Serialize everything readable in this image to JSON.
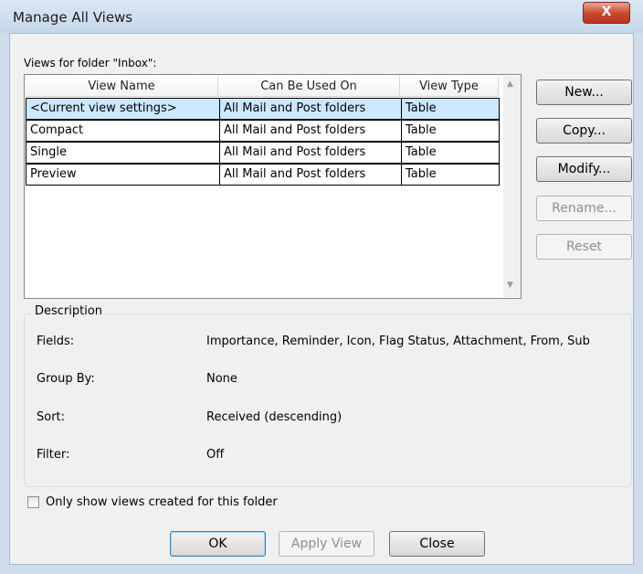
{
  "dialog": {
    "title": "Manage All Views",
    "close_glyph": "X",
    "views_label": "Views for folder \"Inbox\":"
  },
  "table": {
    "columns": [
      "View Name",
      "Can Be Used On",
      "View Type"
    ],
    "rows": [
      {
        "name": "<Current view settings>",
        "used_on": "All Mail and Post folders",
        "type": "Table",
        "selected": true
      },
      {
        "name": "Compact",
        "used_on": "All Mail and Post folders",
        "type": "Table",
        "selected": false
      },
      {
        "name": "Single",
        "used_on": "All Mail and Post folders",
        "type": "Table",
        "selected": false
      },
      {
        "name": "Preview",
        "used_on": "All Mail and Post folders",
        "type": "Table",
        "selected": false
      }
    ]
  },
  "side_buttons": {
    "new": "New...",
    "copy": "Copy...",
    "modify": "Modify...",
    "rename": "Rename...",
    "reset": "Reset"
  },
  "description": {
    "legend": "Description",
    "fields_label": "Fields:",
    "fields_value": "Importance, Reminder, Icon, Flag Status, Attachment, From, Sub",
    "group_label": "Group By:",
    "group_value": "None",
    "sort_label": "Sort:",
    "sort_value": "Received (descending)",
    "filter_label": "Filter:",
    "filter_value": "Off"
  },
  "only_show": {
    "label": "Only show views created for this folder",
    "checked": false
  },
  "bottom_buttons": {
    "ok": "OK",
    "apply": "Apply View",
    "close": "Close"
  },
  "colors": {
    "selection": "#cce8ff",
    "close_button": "#c9452c"
  }
}
